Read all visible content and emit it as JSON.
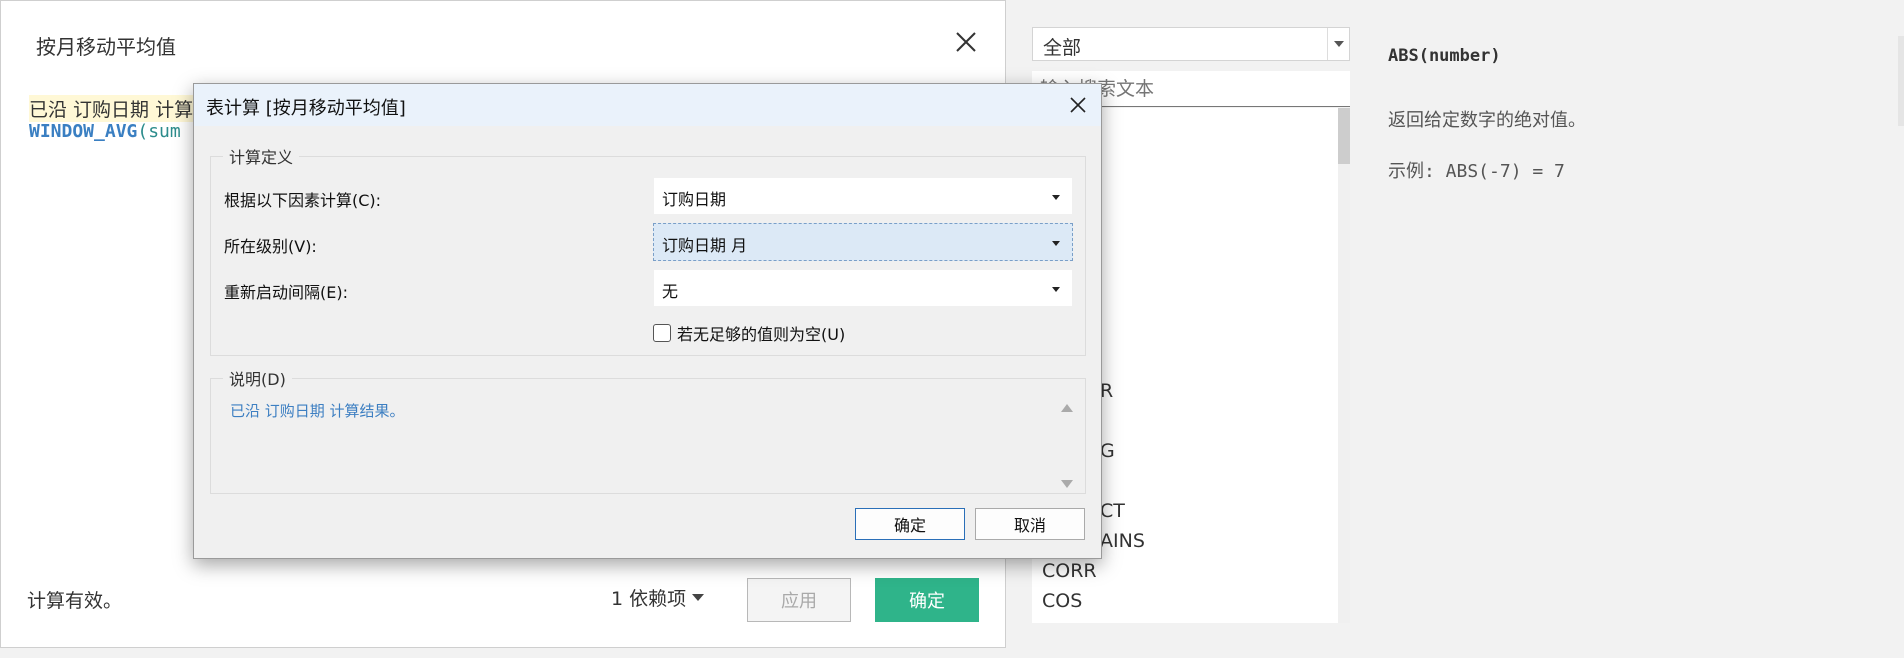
{
  "editor": {
    "title": "按月移动平均值",
    "formula_line1": "已沿 订购日期 计算",
    "formula_func": "WINDOW_AVG",
    "formula_rest": "(sum",
    "status": "计算有效。",
    "dependencies": "1 依赖项",
    "apply_label": "应用",
    "ok_label": "确定"
  },
  "functions": {
    "filter_value": "全部",
    "search_placeholder": "输入搜索文本",
    "visible_items": [
      "R",
      "G",
      "CT",
      "AINS",
      "CORR",
      "COS"
    ],
    "signature": "ABS(number)",
    "description": "返回给定数字的绝对值。",
    "example": "示例: ABS(-7) = 7"
  },
  "dialog": {
    "title": "表计算 [按月移动平均值]",
    "group_definition": "计算定义",
    "compute_using_label": "根据以下因素计算(C):",
    "compute_using_value": "订购日期",
    "at_level_label": "所在级别(V):",
    "at_level_value": "订购日期 月",
    "restart_label": "重新启动间隔(E):",
    "restart_value": "无",
    "null_if_not_enough": "若无足够的值则为空(U)",
    "group_description": "说明(D)",
    "description_text": "已沿 订购日期 计算结果。",
    "ok_label": "确定",
    "cancel_label": "取消"
  },
  "colors": {
    "accent_green": "#2fb48a",
    "link_blue": "#3d7fc2",
    "titlebar": "#eaf2fb"
  }
}
